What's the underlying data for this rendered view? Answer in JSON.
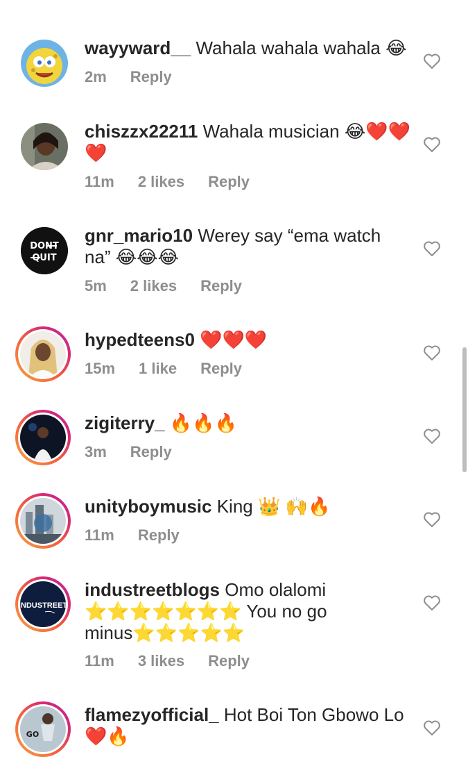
{
  "comments": [
    {
      "username": "wayyward__",
      "text": "Wahala wahala wahala 😂",
      "time": "2m",
      "likes": "",
      "reply": "Reply",
      "avatar": "sponge-avatar"
    },
    {
      "username": "chiszzx22211",
      "text": "Wahala musician 😂❤️❤️❤️",
      "time": "11m",
      "likes": "2 likes",
      "reply": "Reply",
      "avatar": "woman-avatar"
    },
    {
      "username": "gnr_mario10",
      "text": "Werey say “ema watch na” 😂😂😂",
      "time": "5m",
      "likes": "2 likes",
      "reply": "Reply",
      "avatar": "dont-quit-avatar",
      "avatar_text_1": "DONT",
      "avatar_text_2": "QUIT"
    },
    {
      "username": "hypedteens0",
      "text": "❤️❤️❤️",
      "time": "15m",
      "likes": "1 like",
      "reply": "Reply",
      "avatar": "braids-avatar"
    },
    {
      "username": "zigiterry_",
      "text": "🔥🔥🔥",
      "time": "3m",
      "likes": "",
      "reply": "Reply",
      "avatar": "performer-avatar"
    },
    {
      "username": "unityboymusic",
      "text": "King 👑 🙌🔥",
      "time": "11m",
      "likes": "",
      "reply": "Reply",
      "avatar": "city-avatar"
    },
    {
      "username": "industreetblogs",
      "text": "Omo olalomi ⭐⭐⭐⭐⭐⭐⭐ You no go minus⭐⭐⭐⭐⭐",
      "time": "11m",
      "likes": "3 likes",
      "reply": "Reply",
      "avatar": "industreet-avatar",
      "avatar_text": "INDUSTREET"
    },
    {
      "username": "flamezyofficial_",
      "text": "Hot Boi Ton Gbowo Lo ❤️🔥",
      "time": "",
      "likes": "",
      "reply": "",
      "avatar": "go-avatar",
      "avatar_text": "GO"
    }
  ],
  "colors": {
    "username": "#262626",
    "meta": "#8e8e8e",
    "ring_start": "#f9a33f",
    "ring_end": "#b82a9a"
  }
}
